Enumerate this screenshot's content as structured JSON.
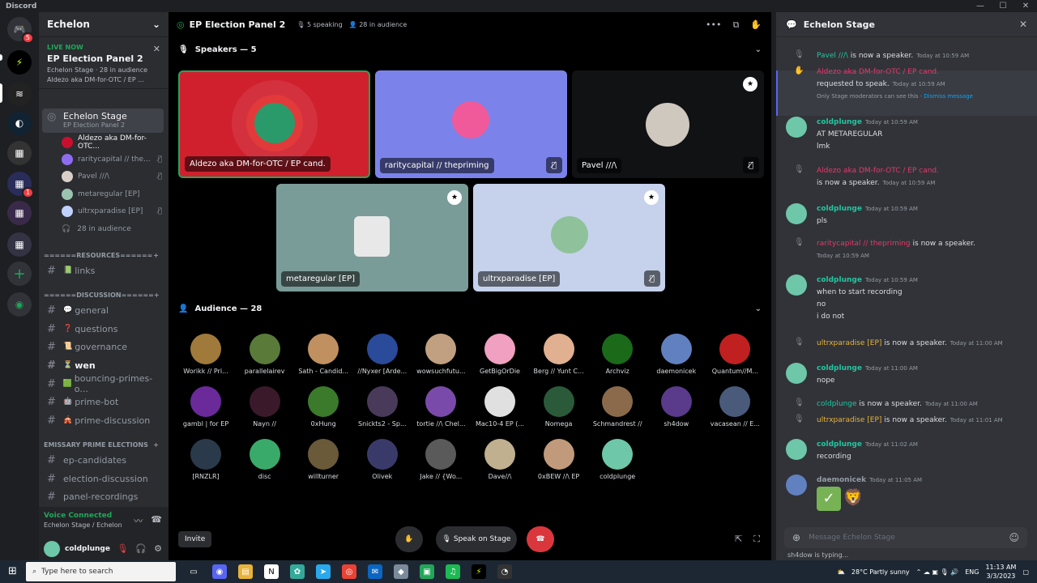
{
  "window": {
    "app": "Discord"
  },
  "server": {
    "name": "Echelon"
  },
  "live": {
    "label": "LIVE NOW",
    "title": "EP Election Panel 2",
    "sub1": "Echelon Stage · ",
    "audience": "28 in audience",
    "sub2": "Aldezo aka DM-for-OTC / EP ..."
  },
  "stage_channel": {
    "name": "Echelon Stage",
    "sub": "EP Election Panel 2",
    "audience": "28 in audience",
    "members": [
      {
        "name": "Aldezo aka DM-for-OTC...",
        "color": "#c8102e"
      },
      {
        "name": "raritycapital // the...",
        "color": "#8e6cef"
      },
      {
        "name": "Pavel ///\\",
        "color": "#d8d0c8"
      },
      {
        "name": "metaregular [EP]",
        "color": "#9bc4b0"
      },
      {
        "name": "ultrxparadise [EP]",
        "color": "#c0d0ff"
      }
    ]
  },
  "categories": {
    "resources": "======RESOURCES======",
    "discussion": "======DISCUSSION======",
    "emissary": "EMISSARY PRIME ELECTIONS"
  },
  "channels": {
    "links": "links",
    "general": "general",
    "questions": "questions",
    "governance": "governance",
    "wen": "wen",
    "bouncing": "bouncing-primes-o...",
    "primebot": "prime-bot",
    "primedisc": "prime-discussion",
    "epcand": "ep-candidates",
    "electiondisc": "election-discussion",
    "panelrec": "panel-recordings"
  },
  "voice": {
    "status": "Voice Connected",
    "location": "Echelon Stage / Echelon"
  },
  "user": {
    "name": "coldplunge"
  },
  "header": {
    "title": "EP Election Panel 2",
    "speaking": "5 speaking",
    "audience": "28 in audience"
  },
  "speakers": {
    "heading": "Speakers — 5",
    "tiles": [
      {
        "name": "Aldezo aka DM-for-OTC / EP cand.",
        "bg": "#d0202e"
      },
      {
        "name": "raritycapital // thepriming",
        "bg": "#7b83eb"
      },
      {
        "name": "Pavel ///\\",
        "bg": "#111214"
      },
      {
        "name": "metaregular [EP]",
        "bg": "#7a9c98"
      },
      {
        "name": "ultrxparadise [EP]",
        "bg": "#c6d2ec"
      }
    ]
  },
  "audience": {
    "heading": "Audience — 28",
    "people": [
      {
        "name": "Worikk // Pri...",
        "c": "#a07a3a"
      },
      {
        "name": "parallelairev",
        "c": "#5a7a3a"
      },
      {
        "name": "Sath - Candid...",
        "c": "#c09060"
      },
      {
        "name": "//Nyxer [Arde...",
        "c": "#2a4a9a"
      },
      {
        "name": "wowsuchfutu...",
        "c": "#c0a080"
      },
      {
        "name": "GetBigOrDie",
        "c": "#f0a0c0"
      },
      {
        "name": "Berg // Yunt C...",
        "c": "#e0b090"
      },
      {
        "name": "Archviz",
        "c": "#1a6a1a"
      },
      {
        "name": "daemonicek",
        "c": "#6080c0"
      },
      {
        "name": "Quantum//M...",
        "c": "#c02020"
      },
      {
        "name": "gambl | for EP",
        "c": "#6a2a9a"
      },
      {
        "name": "Nayn //",
        "c": "#3a1a2a"
      },
      {
        "name": "0xHung",
        "c": "#3a7a2a"
      },
      {
        "name": "Snickts2 - Sp...",
        "c": "#4a3a5a"
      },
      {
        "name": "tortie //\\ Chel...",
        "c": "#7a4aaa"
      },
      {
        "name": "Mac10-4 EP (...",
        "c": "#e0e0e0"
      },
      {
        "name": "Nomega",
        "c": "#2a5a3a"
      },
      {
        "name": "Schmandrest //",
        "c": "#8a6a4a"
      },
      {
        "name": "sh4dow",
        "c": "#5a3a8a"
      },
      {
        "name": "vacasean // E...",
        "c": "#4a5a7a"
      },
      {
        "name": "[RNZLR]",
        "c": "#2a3a4a"
      },
      {
        "name": "disc",
        "c": "#3aaa6a"
      },
      {
        "name": "willturner",
        "c": "#6a5a3a"
      },
      {
        "name": "Olivek",
        "c": "#3a3a6a"
      },
      {
        "name": "Jake // {Wo...",
        "c": "#5a5a5a"
      },
      {
        "name": "Dave//\\",
        "c": "#c0b090"
      },
      {
        "name": "0xBEW //\\ EP",
        "c": "#c09a7a"
      },
      {
        "name": "coldplunge",
        "c": "#6dc7a8"
      }
    ]
  },
  "controls": {
    "invite": "Invite",
    "speak": "Speak on Stage"
  },
  "chat": {
    "title": "Echelon Stage",
    "placeholder": "Message Echelon Stage",
    "typing": "sh4dow is typing...",
    "dismiss": "Only Stage moderators can see this · ",
    "dismiss_link": "Dismiss message",
    "msgs": [
      {
        "author": "Pavel ///\\",
        "text": " is now a speaker.",
        "ts": "Today at 10:59 AM"
      },
      {
        "author": "Aldezo aka DM-for-OTC / EP cand.",
        "text": "requested to speak.",
        "ts": "Today at 10:59 AM"
      },
      {
        "author": "coldplunge",
        "ts": "Today at 10:59 AM",
        "l1": "AT METAREGULAR",
        "l2": "lmk"
      },
      {
        "author": "Aldezo aka DM-for-OTC / EP cand.",
        "text": "is now a speaker.",
        "ts": "Today at 10:59 AM"
      },
      {
        "author": "coldplunge",
        "ts": "Today at 10:59 AM",
        "l1": "pls"
      },
      {
        "author": "raritycapital // thepriming",
        "text": " is now a speaker.",
        "ts": "Today at 10:59 AM"
      },
      {
        "author": "coldplunge",
        "ts": "Today at 10:59 AM",
        "l1": "when to start recording",
        "l2": "no",
        "l3": "i do not"
      },
      {
        "author": "ultrxparadise [EP]",
        "text": " is now a speaker.",
        "ts": "Today at 11:00 AM"
      },
      {
        "author": "coldplunge",
        "ts": "Today at 11:00 AM",
        "l1": "nope"
      },
      {
        "author": "coldplunge",
        "text": " is now a speaker.",
        "ts": "Today at 11:00 AM"
      },
      {
        "author": "ultrxparadise [EP]",
        "text": " is now a speaker.",
        "ts": "Today at 11:01 AM"
      },
      {
        "author": "coldplunge",
        "ts": "Today at 11:02 AM",
        "l1": "recording"
      },
      {
        "author": "daemonicek",
        "ts": "Today at 11:05 AM"
      }
    ]
  },
  "taskbar": {
    "search": "Type here to search",
    "weather": "28°C  Partly sunny",
    "lang": "ENG",
    "time": "11:13 AM",
    "date": "3/3/2023"
  }
}
